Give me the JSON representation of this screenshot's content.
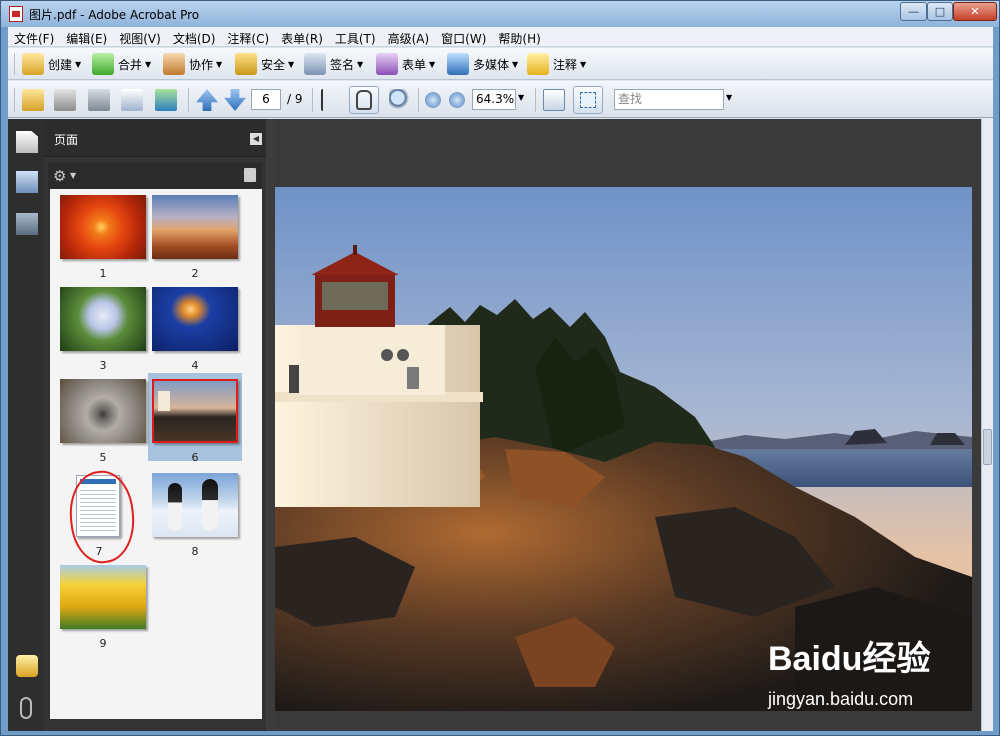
{
  "window": {
    "title": "图片.pdf - Adobe Acrobat Pro",
    "min": "—",
    "max": "□",
    "close": "✕"
  },
  "menu": [
    "文件(F)",
    "编辑(E)",
    "视图(V)",
    "文档(D)",
    "注释(C)",
    "表单(R)",
    "工具(T)",
    "高级(A)",
    "窗口(W)",
    "帮助(H)"
  ],
  "toolbar1": {
    "create": "创建",
    "combine": "合并",
    "collaborate": "协作",
    "secure": "安全",
    "sign": "签名",
    "forms": "表单",
    "multimedia": "多媒体",
    "comment": "注释"
  },
  "toolbar2": {
    "page_current": "6",
    "page_total": "/ 9",
    "zoom": "64.3%",
    "find_placeholder": "查找"
  },
  "pages_panel": {
    "title": "页面",
    "thumbnails": [
      {
        "num": "1",
        "desc": "orange flower"
      },
      {
        "num": "2",
        "desc": "desert"
      },
      {
        "num": "3",
        "desc": "hydrangea"
      },
      {
        "num": "4",
        "desc": "jellyfish"
      },
      {
        "num": "5",
        "desc": "koala"
      },
      {
        "num": "6",
        "desc": "lighthouse",
        "selected": true
      },
      {
        "num": "7",
        "desc": "document screenshot",
        "circled": true
      },
      {
        "num": "8",
        "desc": "penguins"
      },
      {
        "num": "9",
        "desc": "tulips"
      }
    ]
  },
  "watermark": {
    "brand": "Baidu经验",
    "url": "jingyan.baidu.com"
  },
  "colors": {
    "selection": "#a7c2dc",
    "circle": "#e02020",
    "workspace": "#3c3c3c"
  }
}
